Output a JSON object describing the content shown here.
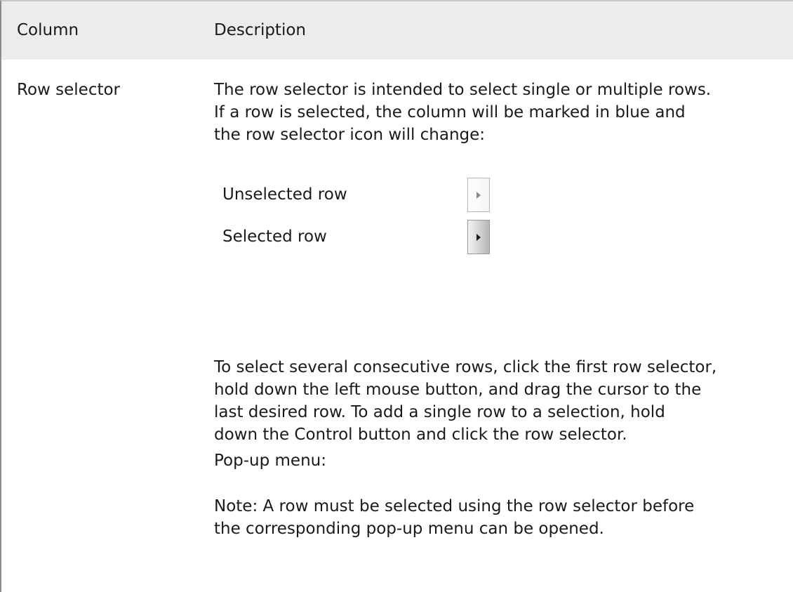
{
  "table": {
    "headers": [
      "Column",
      "Description"
    ],
    "rows": [
      {
        "column": "Row selector",
        "description": {
          "intro": "The row selector is intended to select single or multiple rows.\nIf a row is selected, the column will be marked in blue and\nthe row selector icon will change:",
          "icon_states": [
            {
              "label": "Unselected row",
              "icon": "row-selector-unselected-icon"
            },
            {
              "label": "Selected row",
              "icon": "row-selector-selected-icon"
            }
          ],
          "instructions": "To select several consecutive rows, click the first row selector,\nhold down the left mouse button, and drag the cursor to the\nlast desired row. To add a single row to a selection, hold\ndown the Control button and click the row selector.",
          "popup_label": "Pop-up menu:",
          "note": "Note: A row must be selected using the row selector before\nthe corresponding pop-up menu can be opened."
        }
      }
    ]
  },
  "colors": {
    "header_background": "#ececec",
    "text": "#1a1a1a",
    "border": "#8c8c8c"
  }
}
